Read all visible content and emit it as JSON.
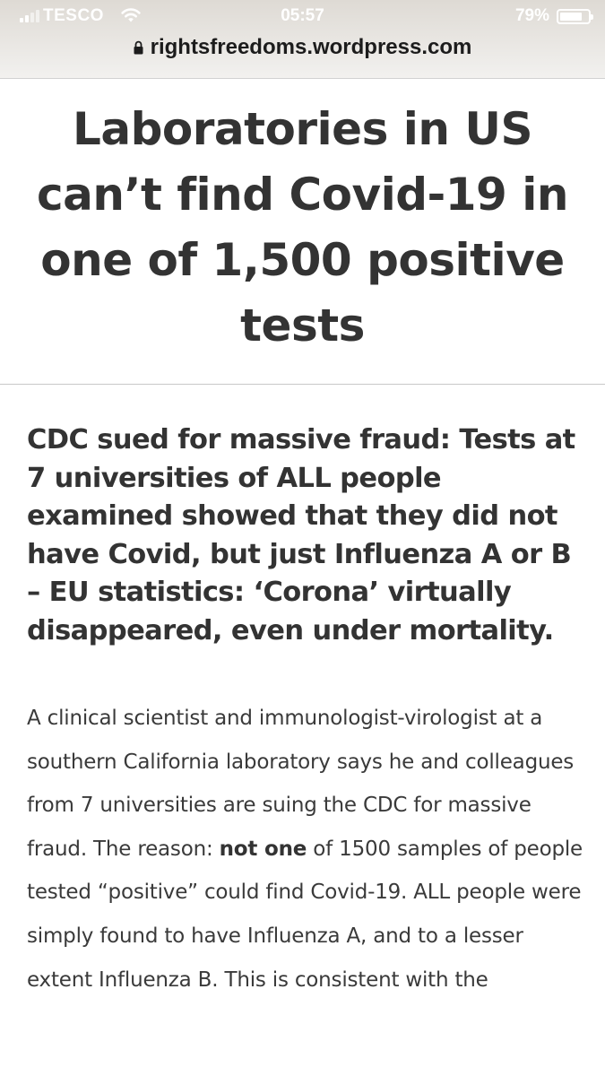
{
  "status_bar": {
    "carrier": "TESCO",
    "time": "05:57",
    "battery_percent_label": "79%",
    "battery_level": 0.79,
    "icons": [
      "signal-icon",
      "wifi-icon",
      "battery-icon"
    ]
  },
  "browser": {
    "url": "rightsfreedoms.wordpress.com",
    "secure_icon": "lock-icon"
  },
  "article": {
    "title": "Laboratories in US can’t find Covid-19 in one of 1,500 positive tests",
    "heading": "CDC sued for massive fraud: Tests at 7 universities of ALL people examined showed that they did not have Covid, but just Influenza A or B – EU statistics: ‘Corona’ virtually disappeared, even under mortality.",
    "paragraph": {
      "before": "A clinical scientist and immunologist-virologist at a southern California laboratory says he and colleagues from 7 universities are suing the CDC for massive fraud. The reason: ",
      "emphasis": "not one",
      "after": " of 1500 samples of people tested “positive” could find Covid-19. ALL people were simply found to have Influenza A, and to a lesser extent Influenza B. This is consistent with the"
    }
  },
  "colors": {
    "text": "#333333",
    "divider": "#c8c8c8",
    "status_text": "#ffffff"
  }
}
